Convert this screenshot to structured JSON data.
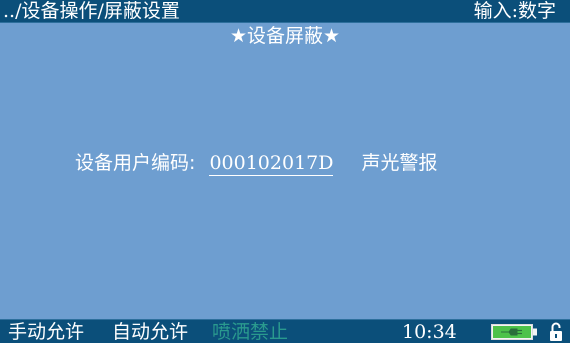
{
  "header": {
    "breadcrumb": "../设备操作/屏蔽设置",
    "input_mode": "输入:数字"
  },
  "main": {
    "title": "★设备屏蔽★",
    "user_code_label": "设备用户编码:",
    "user_code_value": "000102017D",
    "alarm_mode": "声光警报"
  },
  "status_bar": {
    "manual": "手动允许",
    "auto": "自动允许",
    "spray": "喷洒禁止",
    "time": "10:34",
    "battery_icon": "battery-charging-icon",
    "lock_icon": "unlock-icon"
  },
  "colors": {
    "background": "#6e9ed0",
    "bar": "#0b4f7a",
    "disabled_status": "#2a9a8e",
    "battery_fill": "#4ec24a"
  }
}
